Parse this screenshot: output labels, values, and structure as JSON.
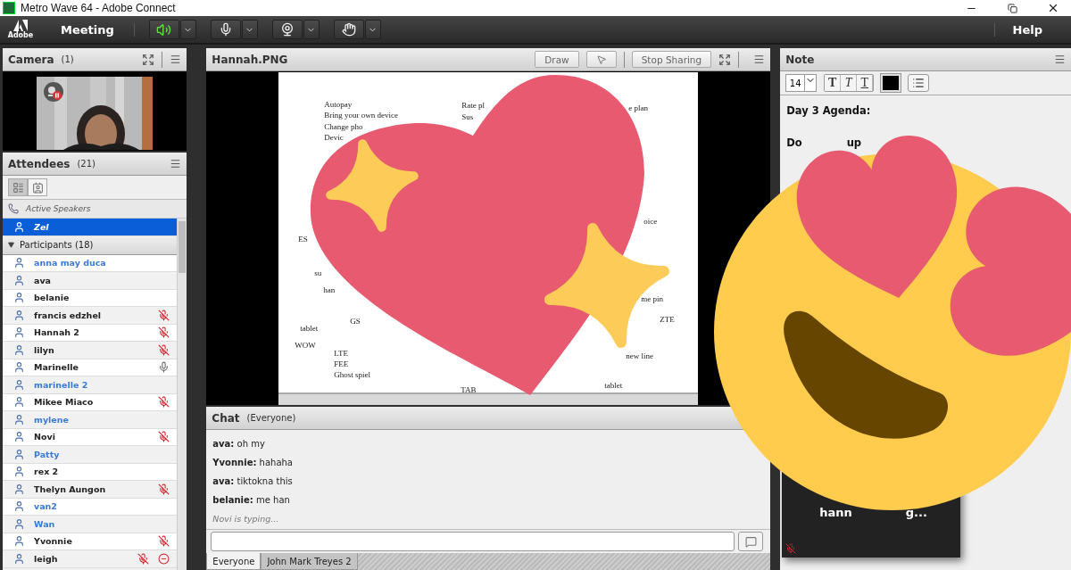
{
  "window": {
    "title": "Metro Wave 64 - Adobe Connect"
  },
  "menu_bar": {
    "logo_text": "Adobe",
    "meeting_menu": "Meeting",
    "help_menu": "Help",
    "controls": [
      {
        "kind": "speaker",
        "on": true
      },
      {
        "kind": "mic",
        "on": false
      },
      {
        "kind": "camera",
        "on": false
      },
      {
        "kind": "hand",
        "on": false
      }
    ]
  },
  "camera_pod": {
    "title": "Camera",
    "count": "(1)",
    "feed": {
      "kind": "picture",
      "paused": true
    }
  },
  "attendees_pod": {
    "title": "Attendees",
    "count": "(21)",
    "active_speakers": "Active Speakers",
    "speakers": [
      {
        "name": "Zel",
        "selected": true
      }
    ],
    "participants": {
      "label": "Participants (18)",
      "expanded": true,
      "rows": [
        {
          "name": "anna may duca",
          "color": "#3a7bd5",
          "mic_on": false,
          "mic_muted": false,
          "away": false,
          "selected": false
        },
        {
          "name": "ava",
          "color": "#222222",
          "mic_on": false,
          "mic_muted": false,
          "away": false,
          "selected": false
        },
        {
          "name": "belanie",
          "color": "#222222",
          "mic_on": false,
          "mic_muted": false,
          "away": false,
          "selected": false
        },
        {
          "name": "francis edzhel",
          "color": "#222222",
          "mic_on": false,
          "mic_muted": true,
          "away": false,
          "selected": false
        },
        {
          "name": "Hannah 2",
          "color": "#222222",
          "mic_on": false,
          "mic_muted": true,
          "away": false,
          "selected": false
        },
        {
          "name": "lilyn",
          "color": "#222222",
          "mic_on": false,
          "mic_muted": true,
          "away": false,
          "selected": false
        },
        {
          "name": "Marinelle",
          "color": "#222222",
          "mic_on": true,
          "mic_muted": false,
          "away": false,
          "selected": false
        },
        {
          "name": "marinelle 2",
          "color": "#3a7bd5",
          "mic_on": false,
          "mic_muted": false,
          "away": false,
          "selected": false
        },
        {
          "name": "Mikee Miaco",
          "color": "#222222",
          "mic_on": false,
          "mic_muted": true,
          "away": false,
          "selected": false
        },
        {
          "name": "mylene",
          "color": "#3a7bd5",
          "mic_on": false,
          "mic_muted": false,
          "away": false,
          "selected": false
        },
        {
          "name": "Novi",
          "color": "#222222",
          "mic_on": false,
          "mic_muted": true,
          "away": false,
          "selected": false
        },
        {
          "name": "Patty",
          "color": "#3a7bd5",
          "mic_on": false,
          "mic_muted": false,
          "away": false,
          "selected": false
        },
        {
          "name": "rex 2",
          "color": "#222222",
          "mic_on": false,
          "mic_muted": false,
          "away": false,
          "selected": false
        },
        {
          "name": "Thelyn Aungon",
          "color": "#222222",
          "mic_on": false,
          "mic_muted": true,
          "away": false,
          "selected": false
        },
        {
          "name": "van2",
          "color": "#3a7bd5",
          "mic_on": false,
          "mic_muted": false,
          "away": false,
          "selected": false
        },
        {
          "name": "Wan",
          "color": "#3a7bd5",
          "mic_on": false,
          "mic_muted": false,
          "away": false,
          "selected": false
        },
        {
          "name": "Yvonnie",
          "color": "#222222",
          "mic_on": false,
          "mic_muted": true,
          "away": false,
          "selected": false
        },
        {
          "name": "leigh",
          "color": "#222222",
          "mic_on": false,
          "mic_muted": true,
          "away": true,
          "selected": false
        }
      ]
    }
  },
  "share_pod": {
    "title": "Hannah.PNG",
    "draw_button": "Draw",
    "stop_button": "Stop Sharing",
    "document_texts": [
      "Autopay",
      "Bring your own device",
      "Change pho",
      "Devic",
      "Rate pl",
      "Sus",
      "e plan",
      "ES",
      "su",
      "han",
      "GS",
      "tablet",
      "WOW",
      "LTE",
      "FEE",
      "Ghost spiel",
      "oice",
      "me pin",
      "ZTE",
      "new line",
      "tablet",
      "TAB"
    ]
  },
  "chat_pod": {
    "title": "Chat",
    "audience": "(Everyone)",
    "messages": [
      "**ava:** oh my",
      "**Yvonnie:** hahaha",
      "**ava:** tiktokna this",
      "**belanie:** me han"
    ],
    "typing": "Novi is typing...",
    "tabs": [
      {
        "label": "Everyone",
        "selected": true
      },
      {
        "label": "John Mark Treyes 2",
        "selected": false
      }
    ]
  },
  "note_pod": {
    "title": "Note",
    "font_size": "14",
    "format_buttons": [
      {
        "label": "T",
        "kind": "bold"
      },
      {
        "label": "T",
        "kind": "italic"
      },
      {
        "label": "T",
        "kind": "underline"
      }
    ],
    "lines": [
      {
        "parts": [
          "Day 3 Agenda:"
        ]
      },
      {
        "parts": [
          "Do",
          "up"
        ]
      }
    ],
    "typing_popup": {
      "parts": [
        "hann",
        "g..."
      ],
      "muted": true
    }
  }
}
